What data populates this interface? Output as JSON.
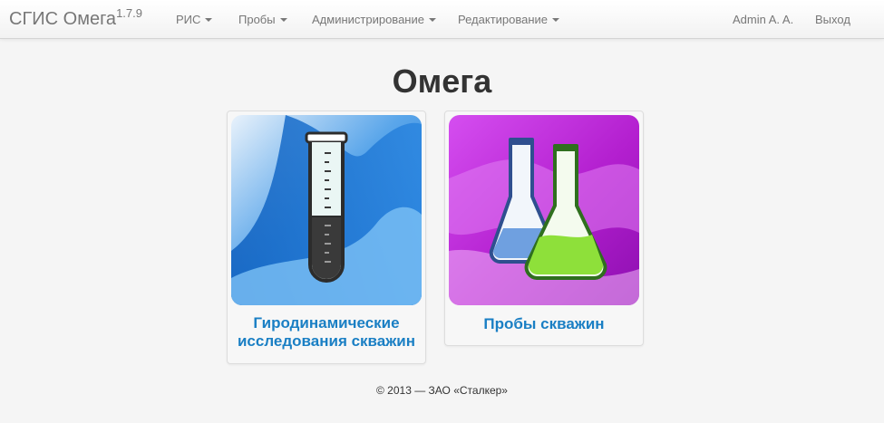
{
  "navbar": {
    "brand": "СГИС Омега",
    "version": "1.7.9",
    "menus": [
      {
        "label": "РИС"
      },
      {
        "label": "Пробы"
      },
      {
        "label": "Администрирование"
      },
      {
        "label": "Редактирование"
      }
    ],
    "user": "Admin A. A.",
    "logout": "Выход"
  },
  "main": {
    "title": "Омега",
    "tiles": [
      {
        "caption_line1": "Гиродинамические",
        "caption_line2": "исследования скважин",
        "icon": "test-tube-icon"
      },
      {
        "caption": "Пробы скважин",
        "icon": "flasks-icon"
      }
    ]
  },
  "footer": {
    "copyright": "© 2013 — ЗАО «Сталкер»"
  },
  "colors": {
    "link": "#1a7fc4",
    "tile1_bg": "#1e6fc9",
    "tile2_bg": "#b21ec9",
    "flask_green": "#8ee03a"
  }
}
